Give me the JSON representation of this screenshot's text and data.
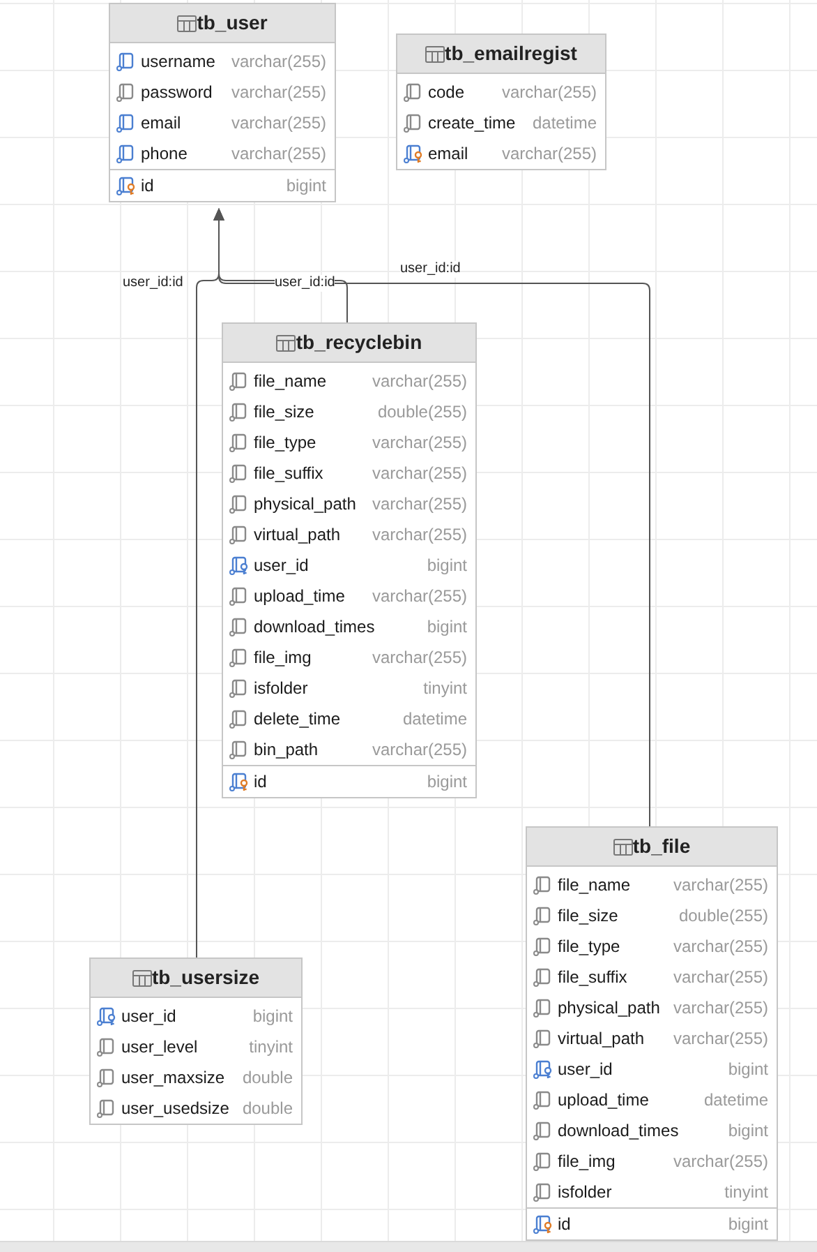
{
  "tables": [
    {
      "name": "tb_user",
      "columns": [
        {
          "name": "username",
          "type": "varchar(255)",
          "kind": "index"
        },
        {
          "name": "password",
          "type": "varchar(255)",
          "kind": "column"
        },
        {
          "name": "email",
          "type": "varchar(255)",
          "kind": "index"
        },
        {
          "name": "phone",
          "type": "varchar(255)",
          "kind": "index"
        }
      ],
      "key_columns": [
        {
          "name": "id",
          "type": "bigint",
          "kind": "pk"
        }
      ]
    },
    {
      "name": "tb_emailregist",
      "columns": [
        {
          "name": "code",
          "type": "varchar(255)",
          "kind": "column"
        },
        {
          "name": "create_time",
          "type": "datetime",
          "kind": "column"
        },
        {
          "name": "email",
          "type": "varchar(255)",
          "kind": "pk"
        }
      ]
    },
    {
      "name": "tb_recyclebin",
      "columns": [
        {
          "name": "file_name",
          "type": "varchar(255)",
          "kind": "column"
        },
        {
          "name": "file_size",
          "type": "double(255)",
          "kind": "column"
        },
        {
          "name": "file_type",
          "type": "varchar(255)",
          "kind": "column"
        },
        {
          "name": "file_suffix",
          "type": "varchar(255)",
          "kind": "column"
        },
        {
          "name": "physical_path",
          "type": "varchar(255)",
          "kind": "column"
        },
        {
          "name": "virtual_path",
          "type": "varchar(255)",
          "kind": "column"
        },
        {
          "name": "user_id",
          "type": "bigint",
          "kind": "fk"
        },
        {
          "name": "upload_time",
          "type": "varchar(255)",
          "kind": "column"
        },
        {
          "name": "download_times",
          "type": "bigint",
          "kind": "column"
        },
        {
          "name": "file_img",
          "type": "varchar(255)",
          "kind": "column"
        },
        {
          "name": "isfolder",
          "type": "tinyint",
          "kind": "column"
        },
        {
          "name": "delete_time",
          "type": "datetime",
          "kind": "column"
        },
        {
          "name": "bin_path",
          "type": "varchar(255)",
          "kind": "column"
        }
      ],
      "key_columns": [
        {
          "name": "id",
          "type": "bigint",
          "kind": "pk"
        }
      ]
    },
    {
      "name": "tb_usersize",
      "columns": [
        {
          "name": "user_id",
          "type": "bigint",
          "kind": "fk"
        },
        {
          "name": "user_level",
          "type": "tinyint",
          "kind": "column"
        },
        {
          "name": "user_maxsize",
          "type": "double",
          "kind": "column"
        },
        {
          "name": "user_usedsize",
          "type": "double",
          "kind": "column"
        }
      ]
    },
    {
      "name": "tb_file",
      "columns": [
        {
          "name": "file_name",
          "type": "varchar(255)",
          "kind": "column"
        },
        {
          "name": "file_size",
          "type": "double(255)",
          "kind": "column"
        },
        {
          "name": "file_type",
          "type": "varchar(255)",
          "kind": "column"
        },
        {
          "name": "file_suffix",
          "type": "varchar(255)",
          "kind": "column"
        },
        {
          "name": "physical_path",
          "type": "varchar(255)",
          "kind": "column"
        },
        {
          "name": "virtual_path",
          "type": "varchar(255)",
          "kind": "column"
        },
        {
          "name": "user_id",
          "type": "bigint",
          "kind": "fk"
        },
        {
          "name": "upload_time",
          "type": "datetime",
          "kind": "column"
        },
        {
          "name": "download_times",
          "type": "bigint",
          "kind": "column"
        },
        {
          "name": "file_img",
          "type": "varchar(255)",
          "kind": "column"
        },
        {
          "name": "isfolder",
          "type": "tinyint",
          "kind": "column"
        }
      ],
      "key_columns": [
        {
          "name": "id",
          "type": "bigint",
          "kind": "pk"
        }
      ]
    }
  ],
  "relations": [
    {
      "label": "user_id:id"
    },
    {
      "label": "user_id:id"
    },
    {
      "label": "user_id:id"
    }
  ]
}
